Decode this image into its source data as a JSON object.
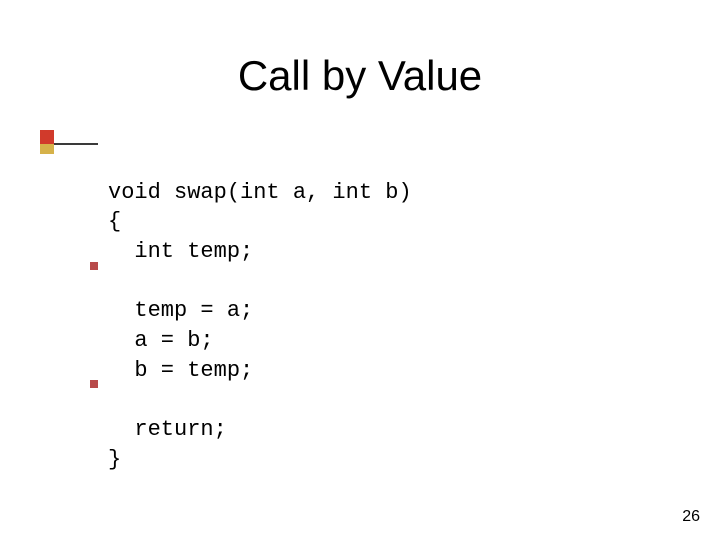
{
  "title": "Call by Value",
  "code": {
    "lines": [
      "void swap(int a, int b)",
      "{",
      "  int temp;",
      "",
      "  temp = a;",
      "  a = b;",
      "  b = temp;",
      "",
      "  return;",
      "}"
    ]
  },
  "page_number": "26",
  "colors": {
    "deco_red": "#d13a2b",
    "deco_gold": "#d6b24a",
    "bullet": "#b84a4a"
  }
}
